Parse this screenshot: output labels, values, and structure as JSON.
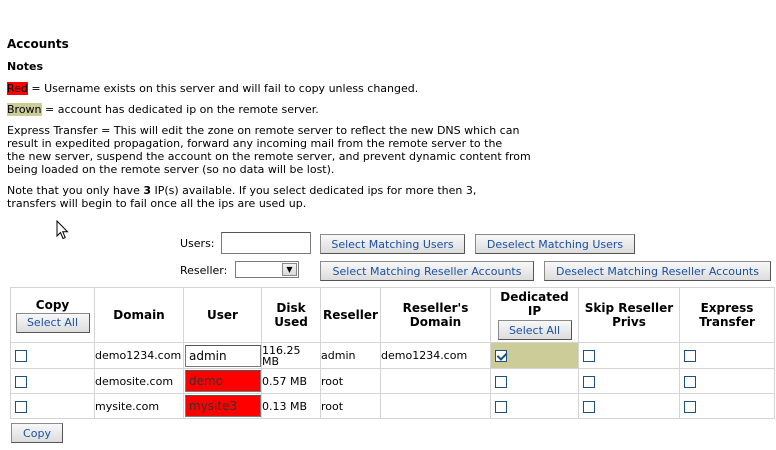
{
  "page": {
    "title": "Accounts",
    "notes_heading": "Notes"
  },
  "notes": {
    "red_word": "Red",
    "red_text": " = Username exists on this server and will fail to copy unless changed.",
    "brown_word": "Brown",
    "brown_text": " = account has dedicated ip on the remote server.",
    "express_lines": [
      "Express Transfer = This will edit the zone on remote server to reflect the new DNS which can",
      "result in expedited propagation, forward any incoming mail from the remote server to the",
      "the new server, suspend the account on the remote server, and prevent dynamic content from",
      "being loaded on the remote server (so no data will be lost)."
    ],
    "ip_line1_pre": "Note that you only have ",
    "ip_count": "3",
    "ip_line1_post": " IP(s) available. If you select dedicated ips for more then 3,",
    "ip_line2": "transfers will begin to fail once all the ips are used up."
  },
  "filters": {
    "users_label": "Users:",
    "users_value": "",
    "reseller_label": "Reseller:",
    "reseller_value": "",
    "select_matching_users": "Select Matching Users",
    "deselect_matching_users": "Deselect Matching Users",
    "select_matching_resellers": "Select Matching Reseller Accounts",
    "deselect_matching_resellers": "Deselect Matching Reseller Accounts"
  },
  "table": {
    "headers": {
      "copy": "Copy",
      "select_all": "Select All",
      "domain": "Domain",
      "user": "User",
      "disk_used_1": "Disk",
      "disk_used_2": "Used",
      "reseller": "Reseller",
      "resellers_domain_1": "Reseller's",
      "resellers_domain_2": "Domain",
      "dedicated_ip_1": "Dedicated",
      "dedicated_ip_2": "IP",
      "dedicated_select_all": "Select All",
      "skip_reseller_privs_1": "Skip Reseller",
      "skip_reseller_privs_2": "Privs",
      "express_transfer_1": "Express",
      "express_transfer_2": "Transfer"
    },
    "rows": [
      {
        "domain": "demo1234.com",
        "user": "admin",
        "disk_used_1": "116.25",
        "disk_used_2": "MB",
        "reseller": "admin",
        "resellers_domain": "demo1234.com",
        "copy": false,
        "dedicated_ip": true,
        "skip_reseller_privs": false,
        "express_transfer": false,
        "user_conflict": false
      },
      {
        "domain": "demosite.com",
        "user": "demo",
        "disk_used_1": "0.57 MB",
        "disk_used_2": "",
        "reseller": "root",
        "resellers_domain": "",
        "copy": false,
        "dedicated_ip": false,
        "skip_reseller_privs": false,
        "express_transfer": false,
        "user_conflict": true
      },
      {
        "domain": "mysite.com",
        "user": "mysite3",
        "disk_used_1": "0.13 MB",
        "disk_used_2": "",
        "reseller": "root",
        "resellers_domain": "",
        "copy": false,
        "dedicated_ip": false,
        "skip_reseller_privs": false,
        "express_transfer": false,
        "user_conflict": true
      }
    ]
  },
  "actions": {
    "copy_button": "Copy"
  },
  "colors": {
    "conflict_red": "#ff0000",
    "dedicated_brown": "#cccc99",
    "button_text": "#1a4fa3",
    "checkbox_border": "#1c5180"
  },
  "icons": [
    "mouse-pointer-icon",
    "chevron-down-icon",
    "checkmark-icon"
  ]
}
